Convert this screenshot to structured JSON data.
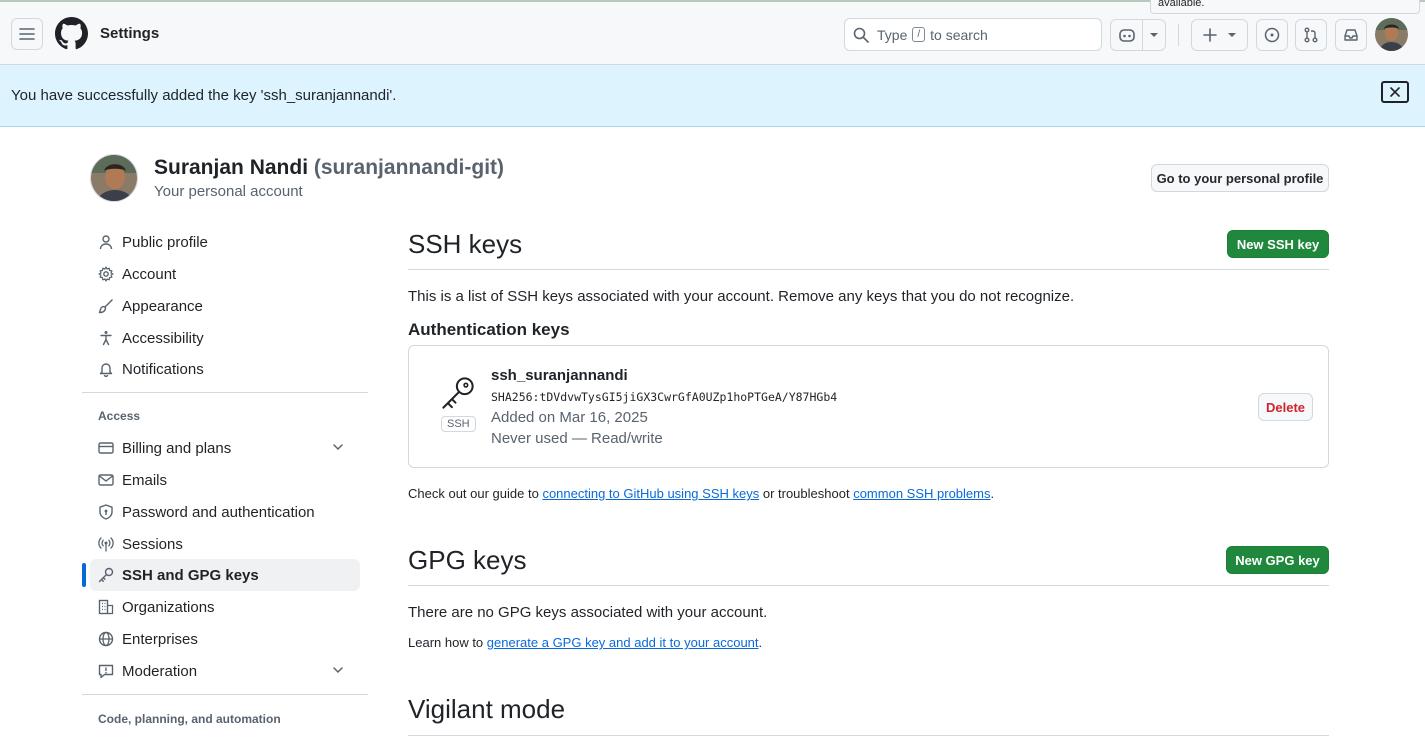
{
  "header": {
    "title": "Settings",
    "search_prefix": "Type",
    "search_key": "/",
    "search_suffix": "to search",
    "tooltip_text": "available."
  },
  "flash": {
    "message": "You have successfully added the key 'ssh_suranjannandi'."
  },
  "user": {
    "name": "Suranjan Nandi",
    "login": "(suranjannandi-git)",
    "subtitle": "Your personal account",
    "profile_button": "Go to your personal profile"
  },
  "sidebar": {
    "items_top": [
      {
        "label": "Public profile",
        "icon": "person-icon"
      },
      {
        "label": "Account",
        "icon": "gear-icon"
      },
      {
        "label": "Appearance",
        "icon": "paintbrush-icon"
      },
      {
        "label": "Accessibility",
        "icon": "accessibility-icon"
      },
      {
        "label": "Notifications",
        "icon": "bell-icon"
      }
    ],
    "access_heading": "Access",
    "items_access": [
      {
        "label": "Billing and plans",
        "icon": "credit-card-icon"
      },
      {
        "label": "Emails",
        "icon": "mail-icon"
      },
      {
        "label": "Password and authentication",
        "icon": "shield-lock-icon"
      },
      {
        "label": "Sessions",
        "icon": "broadcast-icon"
      },
      {
        "label": "SSH and GPG keys",
        "icon": "key-icon"
      },
      {
        "label": "Organizations",
        "icon": "organization-icon"
      },
      {
        "label": "Enterprises",
        "icon": "globe-icon"
      },
      {
        "label": "Moderation",
        "icon": "report-icon"
      }
    ],
    "code_heading": "Code, planning, and automation"
  },
  "ssh": {
    "title": "SSH keys",
    "new_button": "New SSH key",
    "description": "This is a list of SSH keys associated with your account. Remove any keys that you do not recognize.",
    "auth_heading": "Authentication keys",
    "key": {
      "type_label": "SSH",
      "name": "ssh_suranjannandi",
      "fingerprint": "SHA256:tDVdvwTysGI5jiGX3CwrGfA0UZp1hoPTGeA/Y87HGb4",
      "added": "Added on Mar 16, 2025",
      "usage": "Never used — Read/write",
      "delete_button": "Delete"
    },
    "guide_prefix": "Check out our guide to",
    "guide_link": "connecting to GitHub using SSH keys",
    "guide_middle": "or troubleshoot",
    "guide_link2": "common SSH problems",
    "guide_end": "."
  },
  "gpg": {
    "title": "GPG keys",
    "new_button": "New GPG key",
    "empty": "There are no GPG keys associated with your account.",
    "learn_prefix": "Learn how to",
    "learn_link": "generate a GPG key and add it to your account",
    "learn_end": "."
  },
  "vigilant": {
    "title": "Vigilant mode"
  },
  "colors": {
    "primary_green": "#1f883d",
    "link_blue": "#0969da",
    "danger_red": "#d1242f",
    "flash_bg": "#ddf4ff"
  }
}
